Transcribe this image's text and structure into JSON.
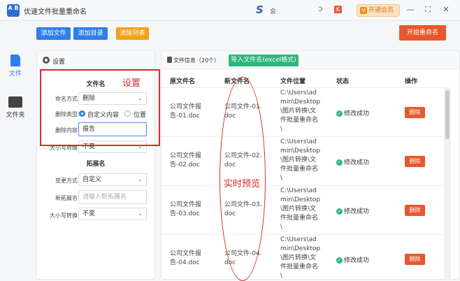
{
  "app": {
    "title": "优速文件批量重命名",
    "logo_text": "A B",
    "user_text": "会",
    "user_text2": "Ͻ",
    "badge": "K",
    "vip_label": "开通会员",
    "vip_icon": "V"
  },
  "window": {
    "min": "—",
    "max": "⛶",
    "close": "✕"
  },
  "nav": [
    {
      "label": "文件",
      "icon": "file-icon",
      "color": "#2f7fe8"
    },
    {
      "label": "文件夹",
      "icon": "folder-icon",
      "color": "#444444"
    }
  ],
  "toolbar": {
    "add_file": "添加文件",
    "add_dir": "添加目录",
    "clear": "清除列表",
    "start": "开始重命名"
  },
  "settings": {
    "title": "设置",
    "section_name": "文件名",
    "naming_label": "命名方式：",
    "naming_value": "删除",
    "del_type_label": "删除类型：",
    "radio_custom": "自定义内容",
    "radio_position": "位置",
    "del_content_label": "删除内容：",
    "del_content_value": "报告",
    "case_label": "大小写转换：",
    "case_value": "不变",
    "section_ext": "拓展名",
    "ext_mode_label": "变更方式：",
    "ext_mode_value": "自定义",
    "new_ext_label": "新拓展名：",
    "new_ext_placeholder": "请输入新拓展名",
    "ext_case_label": "大小写转换：",
    "ext_case_value": "不变"
  },
  "annotations": {
    "settings": "设置",
    "preview": "实时预览"
  },
  "file_panel": {
    "title": "文件信息（20个）",
    "import_button": "导入文件名(excel格式)",
    "columns": [
      "原文件名",
      "新文件名",
      "文件位置",
      "状态",
      "操作"
    ],
    "rows": [
      {
        "orig": [
          "公司文件报",
          "告-01.doc"
        ],
        "new": [
          "公司文件-01.",
          "doc"
        ],
        "loc": [
          "C:\\Users\\ad",
          "min\\Desktop",
          "\\图片转换\\文",
          "件批量重命名",
          "\\"
        ],
        "status": "修改成功",
        "action": "删除"
      },
      {
        "orig": [
          "公司文件报",
          "告-02.doc"
        ],
        "new": [
          "公司文件-02.",
          "doc"
        ],
        "loc": [
          "C:\\Users\\ad",
          "min\\Desktop",
          "\\图片转换\\文",
          "件批量重命名",
          "\\"
        ],
        "status": "修改成功",
        "action": "删除"
      },
      {
        "orig": [
          "公司文件报",
          "告-03.doc"
        ],
        "new": [
          "公司文件-03.",
          "doc"
        ],
        "loc": [
          "C:\\Users\\ad",
          "min\\Desktop",
          "\\图片转换\\文",
          "件批量重命名",
          "\\"
        ],
        "status": "修改成功",
        "action": "删除"
      },
      {
        "orig": [
          "公司文件报",
          "告-04.doc"
        ],
        "new": [
          "公司文件-04.",
          "doc"
        ],
        "loc": [
          "C:\\Users\\ad",
          "min\\Desktop",
          "\\图片转换\\文",
          "件批量重命名",
          "\\"
        ],
        "status": "修改成功",
        "action": "删除"
      }
    ]
  },
  "colors": {
    "accent": "#2f7fe8",
    "danger": "#e8572d",
    "success": "#2db67c",
    "annotation": "#d92b2b"
  }
}
